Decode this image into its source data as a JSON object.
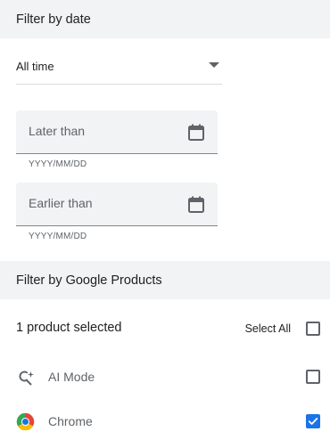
{
  "filter_date": {
    "title": "Filter by date",
    "range_select": {
      "value": "All time"
    },
    "later_than": {
      "placeholder": "Later than",
      "hint": "YYYY/MM/DD"
    },
    "earlier_than": {
      "placeholder": "Earlier than",
      "hint": "YYYY/MM/DD"
    }
  },
  "filter_products": {
    "title": "Filter by Google Products",
    "selected_count": "1 product selected",
    "select_all_label": "Select All",
    "select_all_checked": false,
    "items": [
      {
        "label": "AI Mode",
        "icon": "ai-mode-search-sparkle-icon",
        "checked": false
      },
      {
        "label": "Chrome",
        "icon": "chrome-logo-icon",
        "checked": true
      }
    ]
  },
  "colors": {
    "header_bg": "#f1f3f4",
    "accent": "#1a73e8",
    "text_primary": "#202124",
    "text_secondary": "#5f6368"
  }
}
